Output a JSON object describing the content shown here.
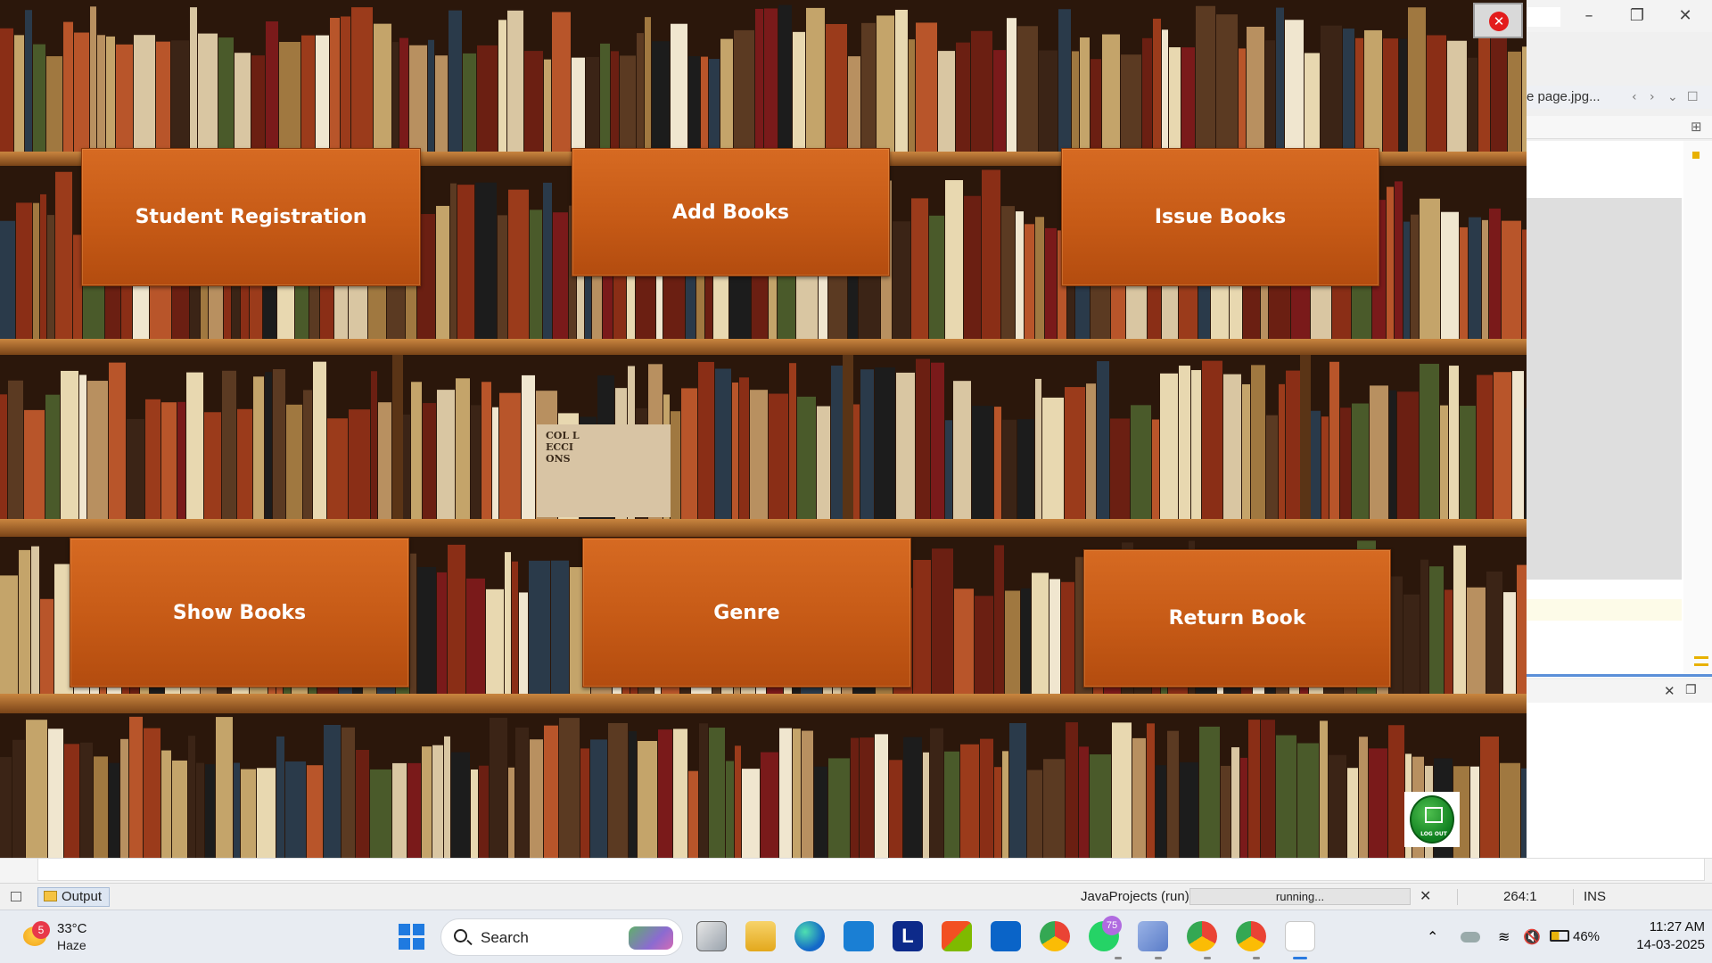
{
  "ide": {
    "editor_tab": "e page.jpg...",
    "output_tab": "Output",
    "project_run": "JavaProjects (run)",
    "progress_text": "running...",
    "caret_position": "264:1",
    "insert_mode": "INS"
  },
  "app": {
    "buttons": {
      "student_registration": "Student Registration",
      "add_books": "Add Books",
      "issue_books": "Issue Books",
      "show_books": "Show Books",
      "genre": "Genre",
      "return_book": "Return Book"
    },
    "close_symbol": "✕",
    "logout_label": "LOG OUT",
    "colors": {
      "button": "#c65a16",
      "close": "#e31c1c",
      "logout": "#0f7f1f"
    }
  },
  "taskbar": {
    "weather": {
      "badge": "5",
      "temp": "33°C",
      "condition": "Haze"
    },
    "search_placeholder": "Search",
    "whatsapp_badge": "75",
    "launcher_letter": "L",
    "battery": "46%",
    "time": "11:27 AM",
    "date": "14-03-2025"
  }
}
